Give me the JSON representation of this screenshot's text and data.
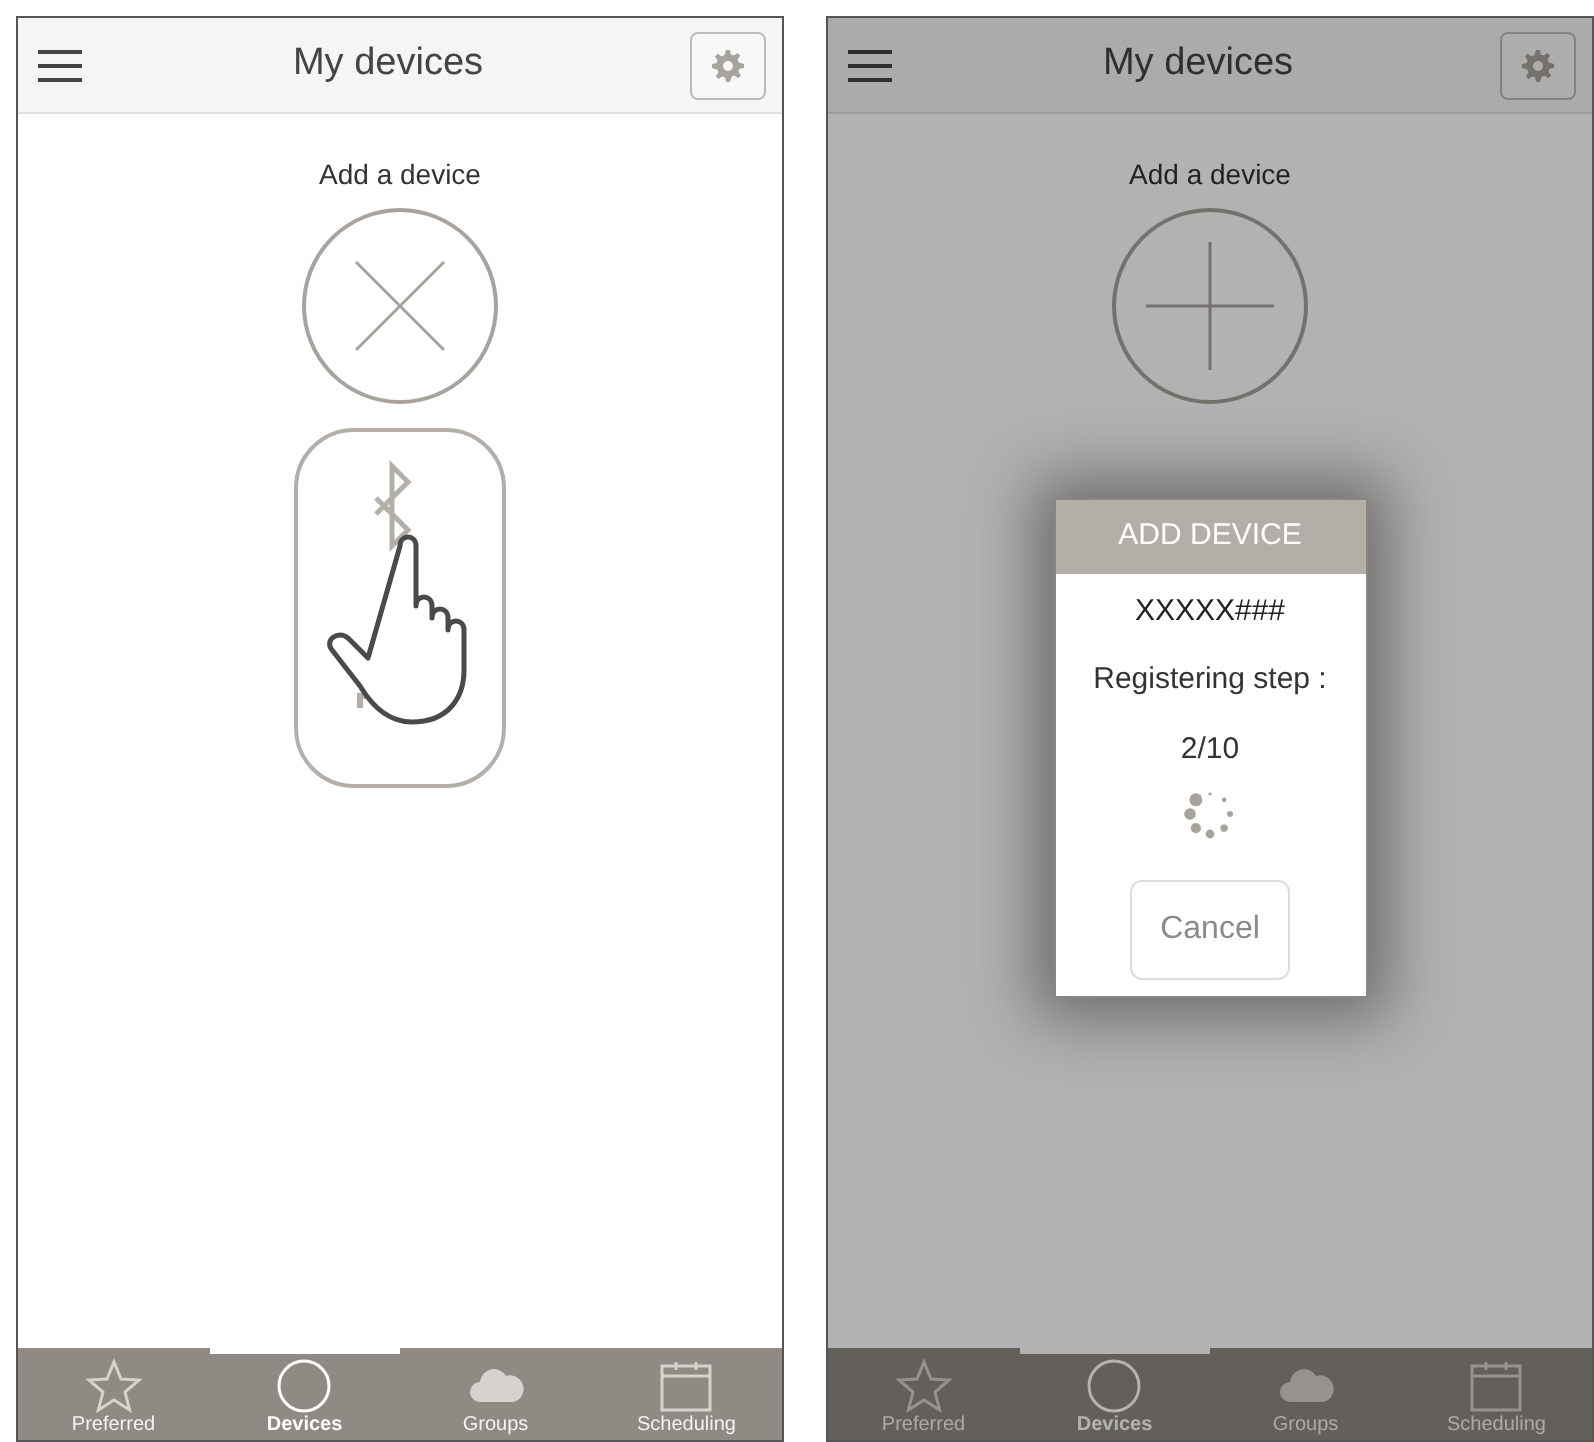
{
  "screens": [
    {
      "header": {
        "title": "My devices"
      },
      "add_device": {
        "label": "Add a device",
        "kind": "close"
      },
      "device_card": {
        "kind": "bluetooth-touch"
      },
      "tabs": [
        {
          "label": "Preferred",
          "kind": "star",
          "selected": false
        },
        {
          "label": "Devices",
          "kind": "circle",
          "selected": true
        },
        {
          "label": "Groups",
          "kind": "cloud",
          "selected": false
        },
        {
          "label": "Scheduling",
          "kind": "calendar",
          "selected": false
        }
      ]
    },
    {
      "header": {
        "title": "My devices"
      },
      "add_device": {
        "label": "Add a device",
        "kind": "plus"
      },
      "dialog": {
        "title": "ADD DEVICE",
        "device": "XXXXX###",
        "step_label": "Registering step :",
        "step": "2/10",
        "button": {
          "label": "Cancel",
          "disabled": true
        }
      },
      "tabs": [
        {
          "label": "Preferred",
          "kind": "star",
          "selected": false
        },
        {
          "label": "Devices",
          "kind": "circle",
          "selected": true
        },
        {
          "label": "Groups",
          "kind": "cloud",
          "selected": false
        },
        {
          "label": "Scheduling",
          "kind": "calendar",
          "selected": false
        }
      ]
    }
  ]
}
